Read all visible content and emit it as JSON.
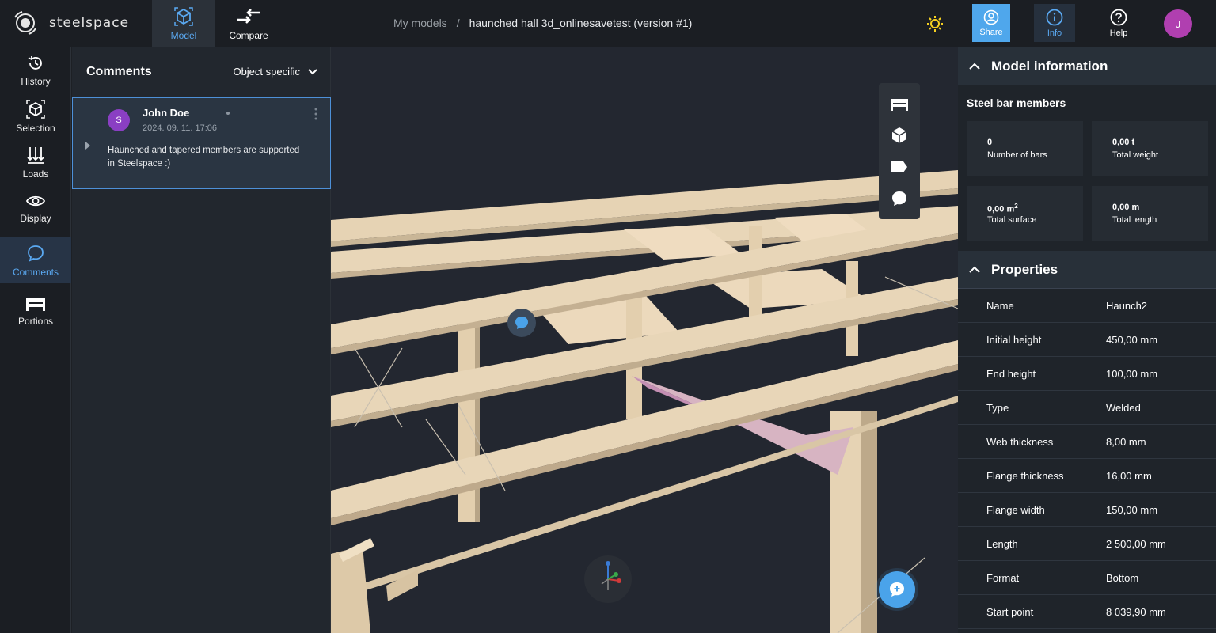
{
  "app": {
    "name": "steelspace"
  },
  "topnav": {
    "model": "Model",
    "compare": "Compare"
  },
  "breadcrumb": {
    "root": "My models",
    "separator": "/",
    "current": "haunched hall 3d_onlinesavetest (version #1)"
  },
  "top_actions": {
    "share": "Share",
    "info": "Info",
    "help": "Help",
    "user_initial": "J"
  },
  "sidebar": {
    "items": [
      {
        "label": "History"
      },
      {
        "label": "Selection"
      },
      {
        "label": "Loads"
      },
      {
        "label": "Display"
      },
      {
        "label": "Comments"
      },
      {
        "label": "Portions"
      }
    ]
  },
  "comments": {
    "title": "Comments",
    "filter": "Object specific",
    "items": [
      {
        "initial": "S",
        "author": "John Doe",
        "date": "2024. 09. 11. 17:06",
        "text": "Haunched and tapered members are supported in Steelspace :)"
      }
    ]
  },
  "model_info": {
    "title": "Model information",
    "subtitle": "Steel bar members",
    "stats": [
      {
        "value": "0",
        "unit": "",
        "sup": "",
        "label": "Number of bars"
      },
      {
        "value": "0,00",
        "unit": "t",
        "sup": "",
        "label": "Total weight"
      },
      {
        "value": "0,00",
        "unit": "m",
        "sup": "2",
        "label": "Total surface"
      },
      {
        "value": "0,00",
        "unit": "m",
        "sup": "",
        "label": "Total length"
      }
    ]
  },
  "properties": {
    "title": "Properties",
    "rows": [
      {
        "name": "Name",
        "value": "Haunch2"
      },
      {
        "name": "Initial height",
        "value": "450,00 mm"
      },
      {
        "name": "End height",
        "value": "100,00 mm"
      },
      {
        "name": "Type",
        "value": "Welded"
      },
      {
        "name": "Web thickness",
        "value": "8,00 mm"
      },
      {
        "name": "Flange thickness",
        "value": "16,00 mm"
      },
      {
        "name": "Flange width",
        "value": "150,00 mm"
      },
      {
        "name": "Length",
        "value": "2 500,00 mm"
      },
      {
        "name": "Format",
        "value": "Bottom"
      },
      {
        "name": "Start point",
        "value": "8 039,90 mm"
      }
    ]
  },
  "colors": {
    "accent": "#4fa7ec",
    "avatar_user": "#b03fb0",
    "avatar_comment": "#8a3fc3",
    "steel": "#e8d6b8"
  }
}
